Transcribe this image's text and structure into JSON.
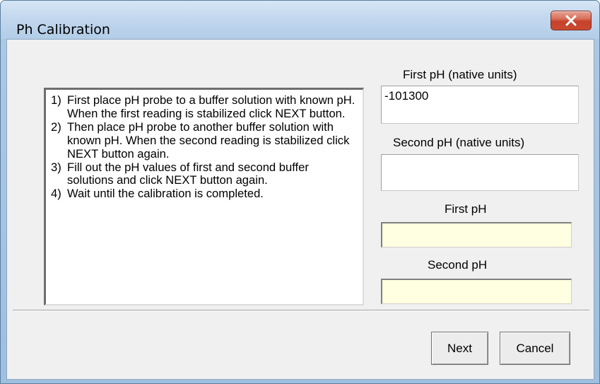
{
  "window": {
    "title": "Ph Calibration",
    "close_glyph": "✕"
  },
  "instructions": [
    {
      "num": "1)",
      "text": "First place pH probe to a buffer solution with known pH.  When the first reading is stabilized click NEXT  button."
    },
    {
      "num": "2)",
      "text": "Then place pH probe to  another buffer solution with known pH. When the second reading is stabilized click NEXT button again."
    },
    {
      "num": "3)",
      "text": "Fill out the pH values of first and second buffer solutions and click NEXT button again."
    },
    {
      "num": "4)",
      "text": "Wait until the calibration is completed."
    }
  ],
  "fields": {
    "first_native_label": "First pH (native units)",
    "first_native_value": "-101300",
    "second_native_label": "Second pH (native units)",
    "second_native_value": "",
    "first_ph_label": "First pH",
    "first_ph_value": "",
    "second_ph_label": "Second pH",
    "second_ph_value": ""
  },
  "buttons": {
    "next": "Next",
    "cancel": "Cancel"
  },
  "colors": {
    "title_bar": "#c3d8ee",
    "close_button": "#c6412a",
    "client_background": "#f0f0f0",
    "readonly_field": "#ffffe1"
  }
}
